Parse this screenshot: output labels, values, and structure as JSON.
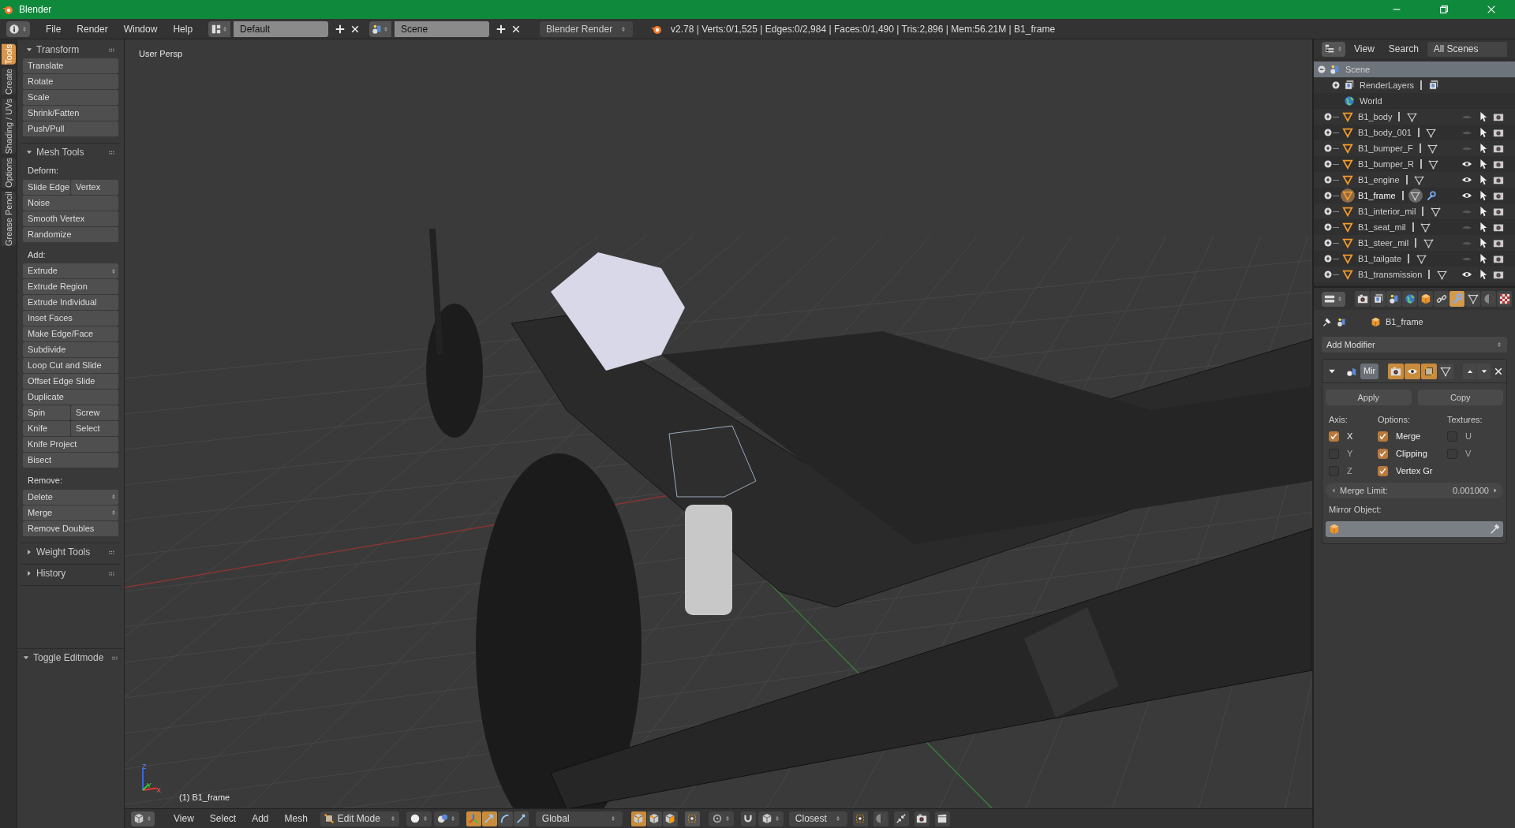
{
  "window": {
    "title": "Blender"
  },
  "top_bar": {
    "menus": [
      "File",
      "Render",
      "Window",
      "Help"
    ],
    "screen_layout": "Default",
    "scene": "Scene",
    "render_engine": "Blender Render",
    "stats": "v2.78 | Verts:0/1,525 | Edges:0/2,984 | Faces:0/1,490 | Tris:2,896 | Mem:56.21M | B1_frame"
  },
  "tool_tabs": [
    {
      "label": "Tools",
      "selected": true
    },
    {
      "label": "Create",
      "selected": false
    },
    {
      "label": "Shading / UVs",
      "selected": false
    },
    {
      "label": "Options",
      "selected": false
    },
    {
      "label": "Grease Pencil",
      "selected": false
    }
  ],
  "tool_panels": [
    {
      "title": "Transform",
      "expanded": true,
      "groups": [
        {
          "rows": [
            [
              {
                "label": "Translate",
                "kind": "button"
              }
            ],
            [
              {
                "label": "Rotate",
                "kind": "button"
              }
            ],
            [
              {
                "label": "Scale",
                "kind": "button"
              }
            ],
            [
              {
                "label": "Shrink/Fatten",
                "kind": "button"
              }
            ],
            [
              {
                "label": "Push/Pull",
                "kind": "button"
              }
            ]
          ]
        }
      ]
    },
    {
      "title": "Mesh Tools",
      "expanded": true,
      "groups": [
        {
          "heading": "Deform:",
          "rows": [
            [
              {
                "label": "Slide Edge",
                "kind": "button"
              },
              {
                "label": "Vertex",
                "kind": "button"
              }
            ],
            [
              {
                "label": "Noise",
                "kind": "button"
              }
            ],
            [
              {
                "label": "Smooth Vertex",
                "kind": "button"
              }
            ],
            [
              {
                "label": "Randomize",
                "kind": "button"
              }
            ]
          ]
        },
        {
          "heading": "Add:",
          "rows": [
            [
              {
                "label": "Extrude",
                "kind": "menu"
              }
            ],
            [
              {
                "label": "Extrude Region",
                "kind": "button"
              }
            ],
            [
              {
                "label": "Extrude Individual",
                "kind": "button"
              }
            ],
            [
              {
                "label": "Inset Faces",
                "kind": "button"
              }
            ],
            [
              {
                "label": "Make Edge/Face",
                "kind": "button"
              }
            ],
            [
              {
                "label": "Subdivide",
                "kind": "button"
              }
            ],
            [
              {
                "label": "Loop Cut and Slide",
                "kind": "button"
              }
            ],
            [
              {
                "label": "Offset Edge Slide",
                "kind": "button"
              }
            ],
            [
              {
                "label": "Duplicate",
                "kind": "button"
              }
            ],
            [
              {
                "label": "Spin",
                "kind": "button"
              },
              {
                "label": "Screw",
                "kind": "button"
              }
            ],
            [
              {
                "label": "Knife",
                "kind": "button"
              },
              {
                "label": "Select",
                "kind": "button"
              }
            ],
            [
              {
                "label": "Knife Project",
                "kind": "button"
              }
            ],
            [
              {
                "label": "Bisect",
                "kind": "button"
              }
            ]
          ]
        },
        {
          "heading": "Remove:",
          "rows": [
            [
              {
                "label": "Delete",
                "kind": "menu"
              }
            ],
            [
              {
                "label": "Merge",
                "kind": "menu"
              }
            ],
            [
              {
                "label": "Remove Doubles",
                "kind": "button"
              }
            ]
          ]
        }
      ]
    },
    {
      "title": "Weight Tools",
      "expanded": false
    },
    {
      "title": "History",
      "expanded": false
    }
  ],
  "operator_panel": {
    "title": "Toggle Editmode",
    "expanded": true
  },
  "viewport": {
    "view_label": "User Persp",
    "object_label": "(1) B1_frame",
    "axis_labels": [
      "Z",
      "Y",
      "X"
    ]
  },
  "outliner": {
    "menus": [
      "View",
      "Search"
    ],
    "filter": "All Scenes",
    "tree": [
      {
        "label": "Scene",
        "kind": "scene",
        "selected": true,
        "expanded": true,
        "children": [
          {
            "label": "RenderLayers",
            "kind": "render_layers",
            "selected": false,
            "expanded": false
          },
          {
            "label": "World",
            "kind": "world",
            "selected": false
          },
          {
            "label": "B1_body",
            "kind": "mesh",
            "selected": false,
            "expanded": false,
            "active": false,
            "visible": false,
            "has_modifier": false
          },
          {
            "label": "B1_body_001",
            "kind": "mesh",
            "selected": false,
            "expanded": false,
            "active": false,
            "visible": false,
            "has_modifier": false
          },
          {
            "label": "B1_bumper_F",
            "kind": "mesh",
            "selected": false,
            "expanded": false,
            "active": false,
            "visible": false,
            "has_modifier": false
          },
          {
            "label": "B1_bumper_R",
            "kind": "mesh",
            "selected": false,
            "expanded": false,
            "active": false,
            "visible": true,
            "has_modifier": false
          },
          {
            "label": "B1_engine",
            "kind": "mesh",
            "selected": false,
            "expanded": false,
            "active": false,
            "visible": true,
            "has_modifier": false
          },
          {
            "label": "B1_frame",
            "kind": "mesh",
            "selected": false,
            "expanded": false,
            "active": true,
            "visible": true,
            "has_modifier": true
          },
          {
            "label": "B1_interior_mil",
            "kind": "mesh",
            "selected": false,
            "expanded": false,
            "active": false,
            "visible": false,
            "has_modifier": false
          },
          {
            "label": "B1_seat_mil",
            "kind": "mesh",
            "selected": false,
            "expanded": false,
            "active": false,
            "visible": false,
            "has_modifier": false
          },
          {
            "label": "B1_steer_mil",
            "kind": "mesh",
            "selected": false,
            "expanded": false,
            "active": false,
            "visible": false,
            "has_modifier": false
          },
          {
            "label": "B1_tailgate",
            "kind": "mesh",
            "selected": false,
            "expanded": false,
            "active": false,
            "visible": false,
            "has_modifier": false
          },
          {
            "label": "B1_transmission",
            "kind": "mesh",
            "selected": false,
            "expanded": false,
            "active": false,
            "visible": true,
            "has_modifier": false
          }
        ]
      }
    ]
  },
  "properties": {
    "tabs": [
      {
        "kind": "render",
        "selected": false
      },
      {
        "kind": "render_layers",
        "selected": false
      },
      {
        "kind": "scene",
        "selected": false
      },
      {
        "kind": "world",
        "selected": false
      },
      {
        "kind": "object",
        "selected": false
      },
      {
        "kind": "constraints",
        "selected": false
      },
      {
        "kind": "modifiers",
        "selected": true
      },
      {
        "kind": "data",
        "selected": false
      },
      {
        "kind": "material",
        "selected": false
      },
      {
        "kind": "texture",
        "selected": false
      }
    ],
    "context": "B1_frame",
    "add_modifier": "Add Modifier",
    "modifiers": [
      {
        "name": "Mir",
        "expanded": true,
        "toggles": [
          {
            "kind": "render",
            "on": true
          },
          {
            "kind": "viewport",
            "on": true
          },
          {
            "kind": "edit_mode",
            "on": true
          },
          {
            "kind": "cage",
            "on": false
          }
        ],
        "buttons": [
          "Apply",
          "Copy"
        ],
        "columns": [
          {
            "heading": "Axis:",
            "options": [
              {
                "label": "X",
                "checked": true
              },
              {
                "label": "Y",
                "checked": false
              },
              {
                "label": "Z",
                "checked": false
              }
            ]
          },
          {
            "heading": "Options:",
            "options": [
              {
                "label": "Merge",
                "checked": true
              },
              {
                "label": "Clipping",
                "checked": true
              },
              {
                "label": "Vertex Gr",
                "checked": true
              }
            ]
          },
          {
            "heading": "Textures:",
            "options": [
              {
                "label": "U",
                "checked": false
              },
              {
                "label": "V",
                "checked": false
              }
            ]
          }
        ],
        "merge_limit": {
          "label": "Merge Limit:",
          "value": "0.001000"
        },
        "mirror_object": {
          "label": "Mirror Object:"
        }
      }
    ]
  },
  "bottom_bar": {
    "menus": [
      "View",
      "Select",
      "Add",
      "Mesh"
    ],
    "mode": "Edit Mode",
    "manipulators": [
      {
        "kind": "axes",
        "selected": true
      },
      {
        "kind": "translate",
        "selected": true
      },
      {
        "kind": "rotate",
        "selected": false
      },
      {
        "kind": "scale",
        "selected": false
      }
    ],
    "orientation": "Global",
    "select_modes": [
      {
        "kind": "vertex",
        "selected": true
      },
      {
        "kind": "edge",
        "selected": false
      },
      {
        "kind": "face",
        "selected": false
      }
    ],
    "snap_element": "Closest"
  }
}
